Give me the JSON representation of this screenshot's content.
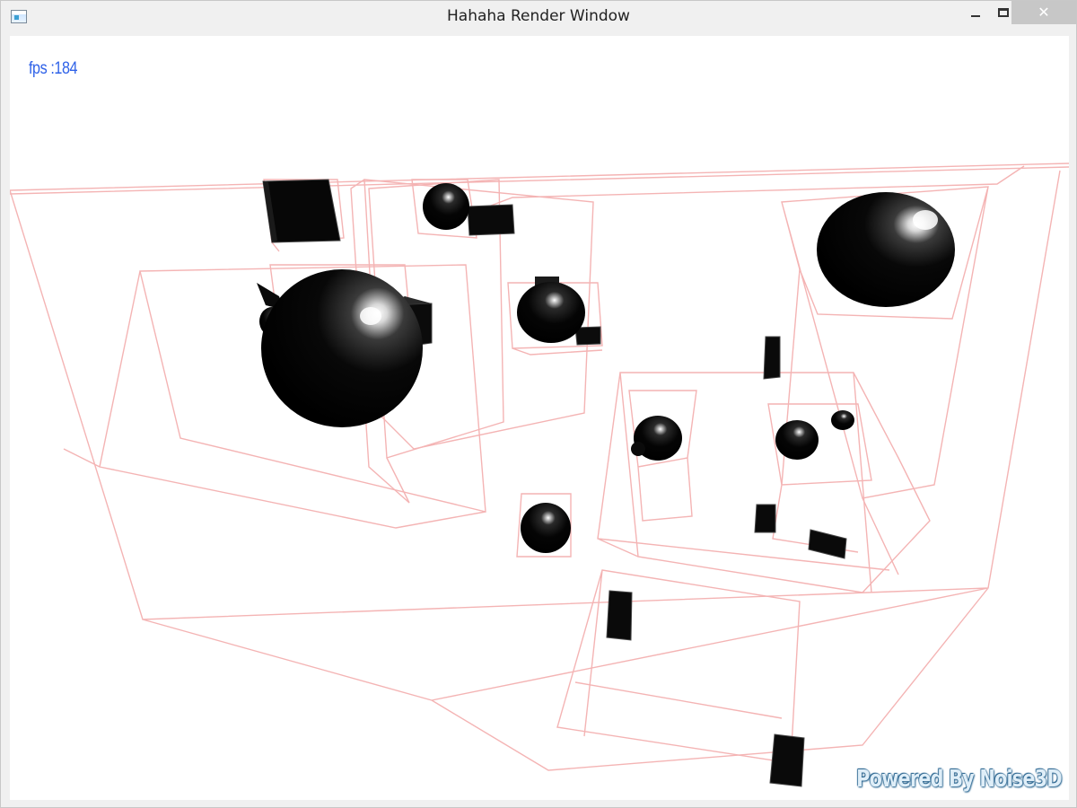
{
  "window": {
    "title": "Hahaha Render Window",
    "icon": "app-window-icon",
    "controls": {
      "minimize_icon": "minimize-icon",
      "maximize_icon": "maximize-icon",
      "close_icon": "close-icon",
      "close_glyph": "✕"
    }
  },
  "viewport": {
    "fps_text": "fps :184",
    "watermark_text": "Powered By Noise3D",
    "colors": {
      "background": "#ffffff",
      "wireframe": "#f4b4b4",
      "object": "#000000",
      "fps": "#2f62e8"
    },
    "scene_objects": [
      "spheres",
      "cubes",
      "bounding-box-wireframes"
    ]
  }
}
